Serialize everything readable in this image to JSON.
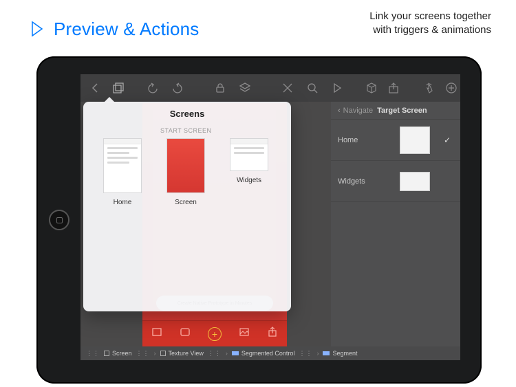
{
  "marketing": {
    "title": "Preview & Actions",
    "sub1": "Link your screens together",
    "sub2": "with triggers & animations"
  },
  "popover": {
    "title": "Screens",
    "section": "START SCREEN",
    "items": [
      {
        "name": "Home"
      },
      {
        "name": "Screen"
      },
      {
        "name": "Widgets"
      }
    ]
  },
  "rightPanel": {
    "back": "Navigate",
    "title": "Target Screen",
    "rows": [
      {
        "name": "Home",
        "selected": true
      },
      {
        "name": "Widgets",
        "selected": false
      }
    ]
  },
  "canvas": {
    "banner": "Create Native Prototype in Minutes"
  },
  "breadcrumb": [
    "Screen",
    "Texture View",
    "Segmented Control",
    "Segment"
  ]
}
